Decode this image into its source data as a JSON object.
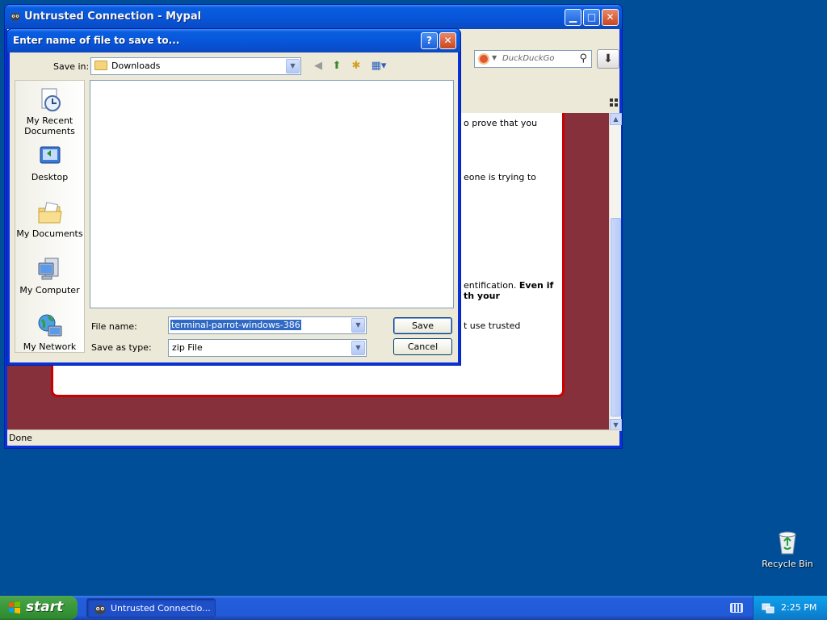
{
  "browser": {
    "title": "Untrusted Connection - Mypal",
    "search_placeholder": "DuckDuckGo",
    "status": "Done",
    "error_fragments": [
      "o prove that you",
      "eone is trying to",
      "entification. ",
      "Even if",
      "th your",
      "t use trusted"
    ]
  },
  "dialog": {
    "title": "Enter name of file to save to...",
    "save_in_label": "Save in:",
    "save_in_value": "Downloads",
    "places": [
      "My Recent Documents",
      "Desktop",
      "My Documents",
      "My Computer",
      "My Network"
    ],
    "file_name_label": "File name:",
    "file_name_value": "terminal-parrot-windows-386",
    "save_as_type_label": "Save as type:",
    "save_as_type_value": "zip File",
    "save_button": "Save",
    "cancel_button": "Cancel"
  },
  "desktop": {
    "recycle_bin_label": "Recycle Bin"
  },
  "taskbar": {
    "start_label": "start",
    "task_item": "Untrusted Connectio...",
    "clock": "2:25 PM"
  },
  "colors": {
    "desktop": "#004e98",
    "error_background": "#85303a",
    "selection": "#316ac5"
  }
}
